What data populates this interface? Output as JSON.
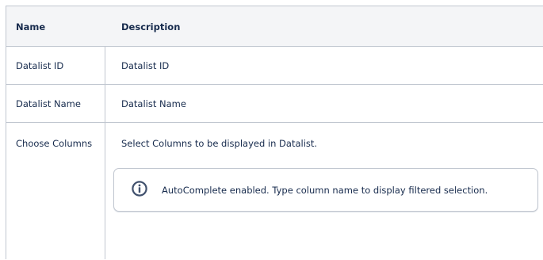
{
  "table": {
    "headers": {
      "name": "Name",
      "description": "Description"
    },
    "rows": [
      {
        "name": "Datalist ID",
        "description": "Datalist ID"
      },
      {
        "name": "Datalist Name",
        "description": "Datalist Name"
      },
      {
        "name": "Choose Columns",
        "description": "Select Columns to be displayed in Datalist."
      }
    ]
  },
  "info_panel": {
    "icon": "info-icon",
    "text": "AutoComplete enabled. Type column name to display filtered selection."
  },
  "colors": {
    "header_background": "#f4f5f7",
    "border": "#c1c7d0",
    "text": "#172b4d",
    "icon": "#42526e"
  }
}
